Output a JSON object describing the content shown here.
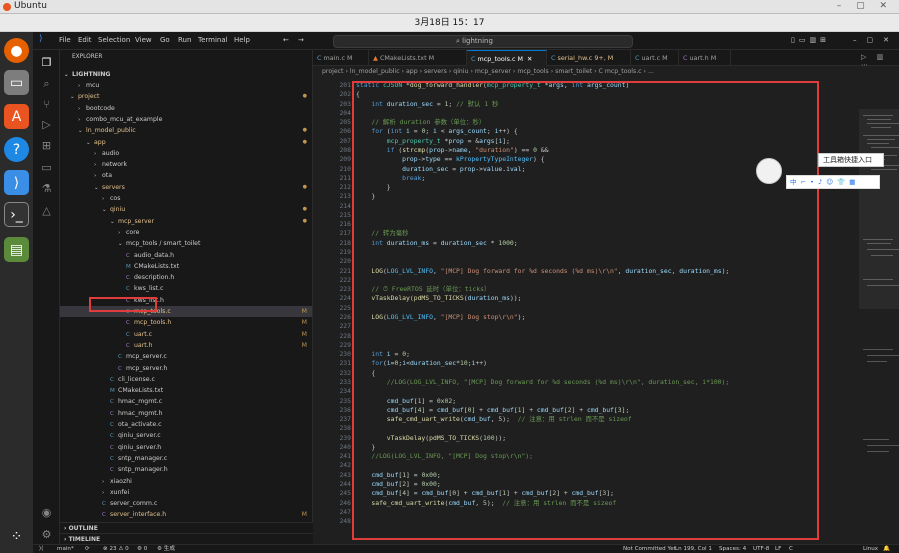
{
  "window": {
    "title": "Ubuntu",
    "controls": "– ▢ ✕"
  },
  "clock": "3月18日  15：17",
  "menu": [
    "File",
    "Edit",
    "Selection",
    "View",
    "Go",
    "Run",
    "Terminal",
    "Help"
  ],
  "search": "lightning",
  "explorer": {
    "title": "EXPLORER",
    "root": "LIGHTNING",
    "items": [
      {
        "label": "mcu",
        "d": 1,
        "ch": "folder",
        "m": false
      },
      {
        "label": "project",
        "d": 0,
        "ch": "open",
        "m": true
      },
      {
        "label": "bootcode",
        "d": 1,
        "ch": "folder",
        "m": false
      },
      {
        "label": "combo_mcu_at_example",
        "d": 1,
        "ch": "folder",
        "m": false
      },
      {
        "label": "ln_model_public",
        "d": 1,
        "ch": "open",
        "m": true
      },
      {
        "label": "app",
        "d": 2,
        "ch": "open",
        "m": true
      },
      {
        "label": "audio",
        "d": 3,
        "ch": "folder",
        "m": false
      },
      {
        "label": "network",
        "d": 3,
        "ch": "folder",
        "m": false
      },
      {
        "label": "ota",
        "d": 3,
        "ch": "folder",
        "m": false
      },
      {
        "label": "servers",
        "d": 3,
        "ch": "open",
        "m": true
      },
      {
        "label": "cos",
        "d": 4,
        "ch": "folder",
        "m": false
      },
      {
        "label": "qiniu",
        "d": 4,
        "ch": "open",
        "m": true
      },
      {
        "label": "mcp_server",
        "d": 5,
        "ch": "open",
        "m": true
      },
      {
        "label": "core",
        "d": 6,
        "ch": "folder",
        "m": false
      },
      {
        "label": "mcp_tools / smart_toilet",
        "d": 6,
        "ch": "open",
        "m": false
      },
      {
        "label": "audio_data.h",
        "d": 7,
        "ch": "C",
        "m": false
      },
      {
        "label": "CMakeLists.txt",
        "d": 7,
        "ch": "M",
        "m": false
      },
      {
        "label": "description.h",
        "d": 7,
        "ch": "C",
        "m": false
      },
      {
        "label": "kws_list.c",
        "d": 7,
        "ch": "C",
        "m": false
      },
      {
        "label": "kws_list.h",
        "d": 7,
        "ch": "C",
        "m": false
      },
      {
        "label": "mcp_tools.c",
        "d": 7,
        "ch": "C",
        "m": true,
        "sel": true
      },
      {
        "label": "mcp_tools.h",
        "d": 7,
        "ch": "C",
        "m": true
      },
      {
        "label": "uart.c",
        "d": 7,
        "ch": "C",
        "m": true
      },
      {
        "label": "uart.h",
        "d": 7,
        "ch": "C",
        "m": true
      },
      {
        "label": "mcp_server.c",
        "d": 6,
        "ch": "C",
        "m": false
      },
      {
        "label": "mcp_server.h",
        "d": 6,
        "ch": "C",
        "m": false
      },
      {
        "label": "cli_license.c",
        "d": 5,
        "ch": "C",
        "m": false
      },
      {
        "label": "CMakeLists.txt",
        "d": 5,
        "ch": "M",
        "m": false
      },
      {
        "label": "hmac_mgmt.c",
        "d": 5,
        "ch": "C",
        "m": false
      },
      {
        "label": "hmac_mgmt.h",
        "d": 5,
        "ch": "C",
        "m": false
      },
      {
        "label": "ota_activate.c",
        "d": 5,
        "ch": "C",
        "m": false
      },
      {
        "label": "qiniu_server.c",
        "d": 5,
        "ch": "C",
        "m": false
      },
      {
        "label": "qiniu_server.h",
        "d": 5,
        "ch": "C",
        "m": false
      },
      {
        "label": "sntp_manager.c",
        "d": 5,
        "ch": "C",
        "m": false
      },
      {
        "label": "sntp_manager.h",
        "d": 5,
        "ch": "C",
        "m": false
      },
      {
        "label": "xiaozhi",
        "d": 4,
        "ch": "folder",
        "m": false
      },
      {
        "label": "xunfei",
        "d": 4,
        "ch": "folder",
        "m": false
      },
      {
        "label": "server_comm.c",
        "d": 4,
        "ch": "C",
        "m": false
      },
      {
        "label": "server_interface.h",
        "d": 4,
        "ch": "C",
        "m": true
      },
      {
        "label": "smarthost",
        "d": 4,
        "ch": "folder",
        "m": false
      }
    ],
    "outline": "OUTLINE",
    "timeline": "TIMELINE"
  },
  "tabs": [
    "main.c  M",
    "CMakeLists.txt  M",
    "mcp_tools.c  M",
    "serial_hw.c  9+, M",
    "uart.c  M",
    "uart.h  M"
  ],
  "breadcrumb": "project › ln_model_public › app › servers › qiniu › mcp_server › mcp_tools › smart_toilet › C  mcp_tools.c › ...",
  "code_start": 201,
  "code": [
    "static cJSON *dog_forward_handler(mcp_property_t *args, int args_count)",
    "{",
    "    int duration_sec = 1; // 默认 1 秒",
    "",
    "    // 解析 duration 参数（单位：秒）",
    "    for (int i = 0; i < args_count; i++) {",
    "        mcp_property_t *prop = &args[i];",
    "        if (strcmp(prop->name, \"duration\") == 0 &&",
    "            prop->type == kPropertyTypeInteger) {",
    "            duration_sec = prop->value.ival;",
    "            break;",
    "        }",
    "    }",
    "",
    "",
    "",
    "    // 转为毫秒",
    "    int duration_ms = duration_sec * 1000;",
    "",
    "",
    "    LOG(LOG_LVL_INFO, \"[MCP] Dog forward for %d seconds (%d ms)\\r\\n\", duration_sec, duration_ms);",
    "",
    "    // ⏱ FreeRTOS 延时（单位：ticks）",
    "    vTaskDelay(pdMS_TO_TICKS(duration_ms));",
    "",
    "    LOG(LOG_LVL_INFO, \"[MCP] Dog stop\\r\\n\");",
    "",
    "",
    "",
    "    int i = 0;",
    "    for(i=0;i<duration_sec*10;i++)",
    "    {",
    "        //LOG(LOG_LVL_INFO, \"[MCP] Dog forward for %d seconds (%d ms)\\r\\n\", duration_sec, i*100);",
    "",
    "        cmd_buf[1] = 0x02;",
    "        cmd_buf[4] = cmd_buf[0] + cmd_buf[1] + cmd_buf[2] + cmd_buf[3];",
    "        safe_cmd_uart_write(cmd_buf, 5);  // 注意：用 strlen 而不是 sizeof",
    "",
    "        vTaskDelay(pdMS_TO_TICKS(100));",
    "    }",
    "    //LOG(LOG_LVL_INFO, \"[MCP] Dog stop\\r\\n\");",
    "",
    "    cmd_buf[1] = 0x00;",
    "    cmd_buf[2] = 0x00;",
    "    cmd_buf[4] = cmd_buf[0] + cmd_buf[1] + cmd_buf[2] + cmd_buf[3];",
    "    safe_cmd_uart_write(cmd_buf, 5);  // 注意：用 strlen 而不是 sizeof",
    "",
    ""
  ],
  "popup": {
    "tab": "工具箱快捷入口",
    "bar": "中 ⌐ • ♪ ☺ 👕 ▦"
  },
  "status": {
    "branch": "main*",
    "sync": "⟳",
    "problems": "⊗ 23 ⚠ 0",
    "ports": "⚙ 0",
    "build": "⚙ 生成",
    "commit": "Not Committed Yet",
    "position": "Ln 199, Col 1",
    "spaces": "Spaces: 4",
    "enc": "UTF-8",
    "eol": "LF",
    "lang": "C",
    "arch": "Linux"
  },
  "accent": "#0078d4"
}
